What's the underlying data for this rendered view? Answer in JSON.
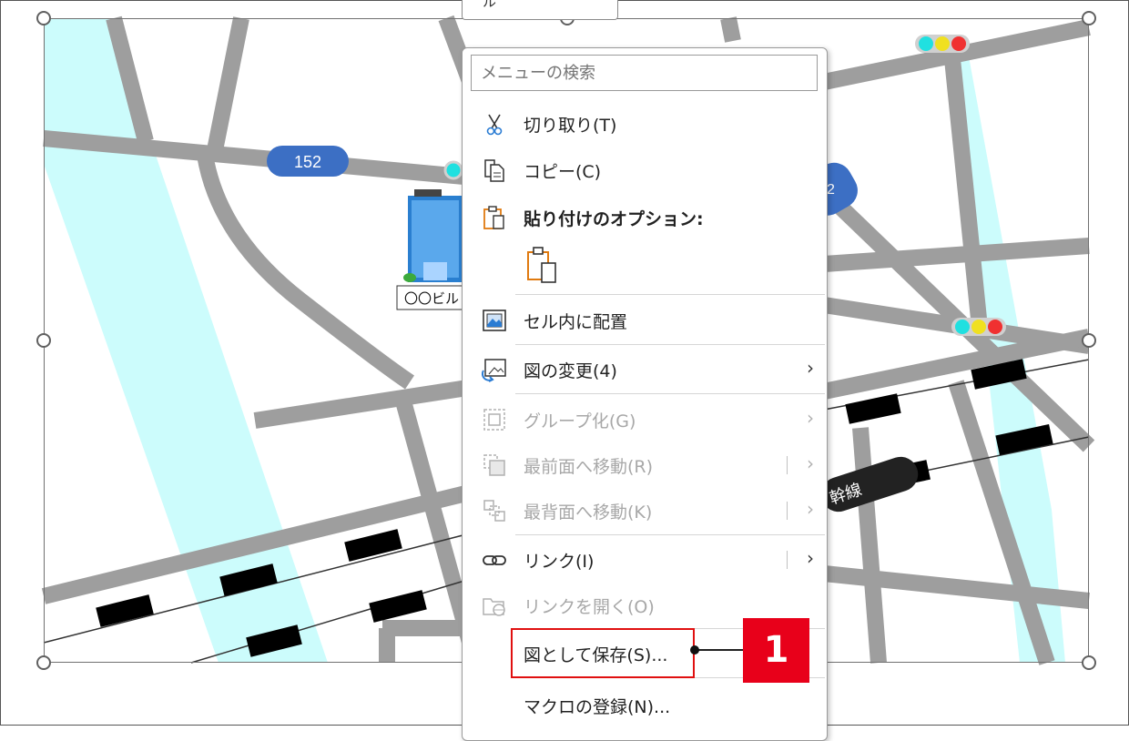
{
  "top_tab": {
    "label": "ル"
  },
  "map": {
    "route_badges": [
      "152",
      "2"
    ],
    "building_label": "〇〇ビル",
    "line_label": "幹線"
  },
  "menu": {
    "search_placeholder": "メニューの検索",
    "items": [
      {
        "label": "切り取り(T)",
        "icon": "scissors-icon",
        "enabled": true
      },
      {
        "label": "コピー(C)",
        "icon": "copy-icon",
        "enabled": true
      },
      {
        "label": "貼り付けのオプション:",
        "icon": "paste-icon",
        "enabled": true,
        "header": true
      },
      {
        "label": "",
        "icon": "paste-option-icon",
        "enabled": true
      },
      {
        "label": "セル内に配置",
        "icon": "place-in-cell-icon",
        "enabled": true
      },
      {
        "label": "図の変更(4)",
        "icon": "change-picture-icon",
        "enabled": true,
        "submenu": true
      },
      {
        "label": "グループ化(G)",
        "icon": "group-icon",
        "enabled": false,
        "submenu": true
      },
      {
        "label": "最前面へ移動(R)",
        "icon": "bring-to-front-icon",
        "enabled": false,
        "submenu": true
      },
      {
        "label": "最背面へ移動(K)",
        "icon": "send-to-back-icon",
        "enabled": false,
        "submenu": true
      },
      {
        "label": "リンク(I)",
        "icon": "link-icon",
        "enabled": true,
        "submenu": true
      },
      {
        "label": "リンクを開く(O)",
        "icon": "open-link-icon",
        "enabled": false
      },
      {
        "label": "図として保存(S)...",
        "icon": "",
        "enabled": true,
        "highlighted": true
      },
      {
        "label": "マクロの登録(N)...",
        "icon": "",
        "enabled": true
      }
    ]
  },
  "callout": {
    "number": "1",
    "color": "#e8001a"
  }
}
